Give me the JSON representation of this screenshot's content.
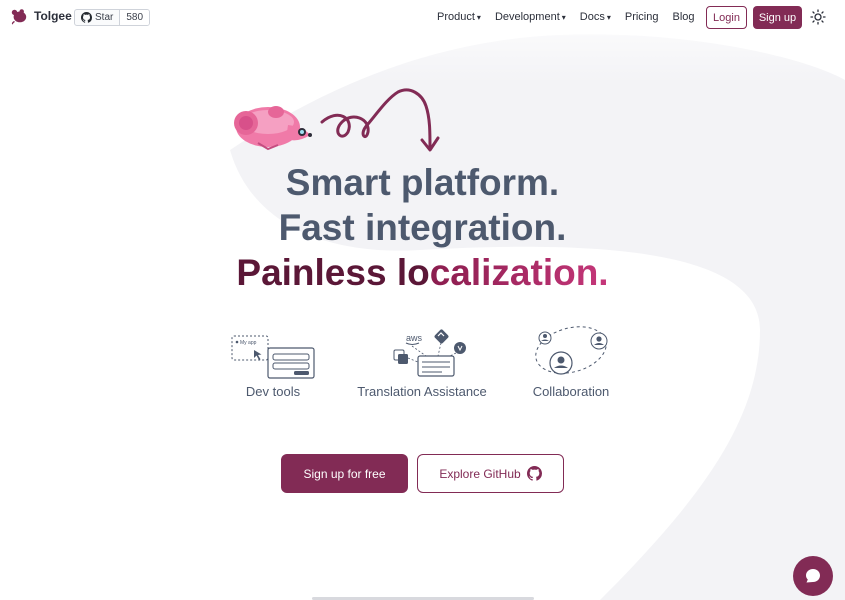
{
  "nav": {
    "brand": "Tolgee",
    "github": {
      "star_label": "Star",
      "count": "580"
    },
    "links": [
      {
        "label": "Product",
        "caret": "▾"
      },
      {
        "label": "Development",
        "caret": "▾"
      },
      {
        "label": "Docs",
        "caret": "▾"
      },
      {
        "label": "Pricing",
        "caret": ""
      },
      {
        "label": "Blog",
        "caret": ""
      }
    ],
    "login_label": "Login",
    "signup_label": "Sign up",
    "theme_icon": "sun-icon"
  },
  "hero": {
    "line1": "Smart platform.",
    "line2": "Fast integration.",
    "line3_dark": "Painless lo",
    "line3_accent": "calization."
  },
  "features": [
    {
      "label": "Dev tools",
      "icon": "dev-tools-icon",
      "app_label": "My app"
    },
    {
      "label": "Translation Assistance",
      "icon": "translation-assistance-icon",
      "aws_label": "aws"
    },
    {
      "label": "Collaboration",
      "icon": "collaboration-icon"
    }
  ],
  "cta": {
    "primary_label": "Sign up for free",
    "secondary_label": "Explore GitHub"
  },
  "colors": {
    "brand": "#822b55",
    "heading": "#4d596e",
    "accent_start": "#8a1d4e",
    "accent_end": "#c6377a"
  }
}
